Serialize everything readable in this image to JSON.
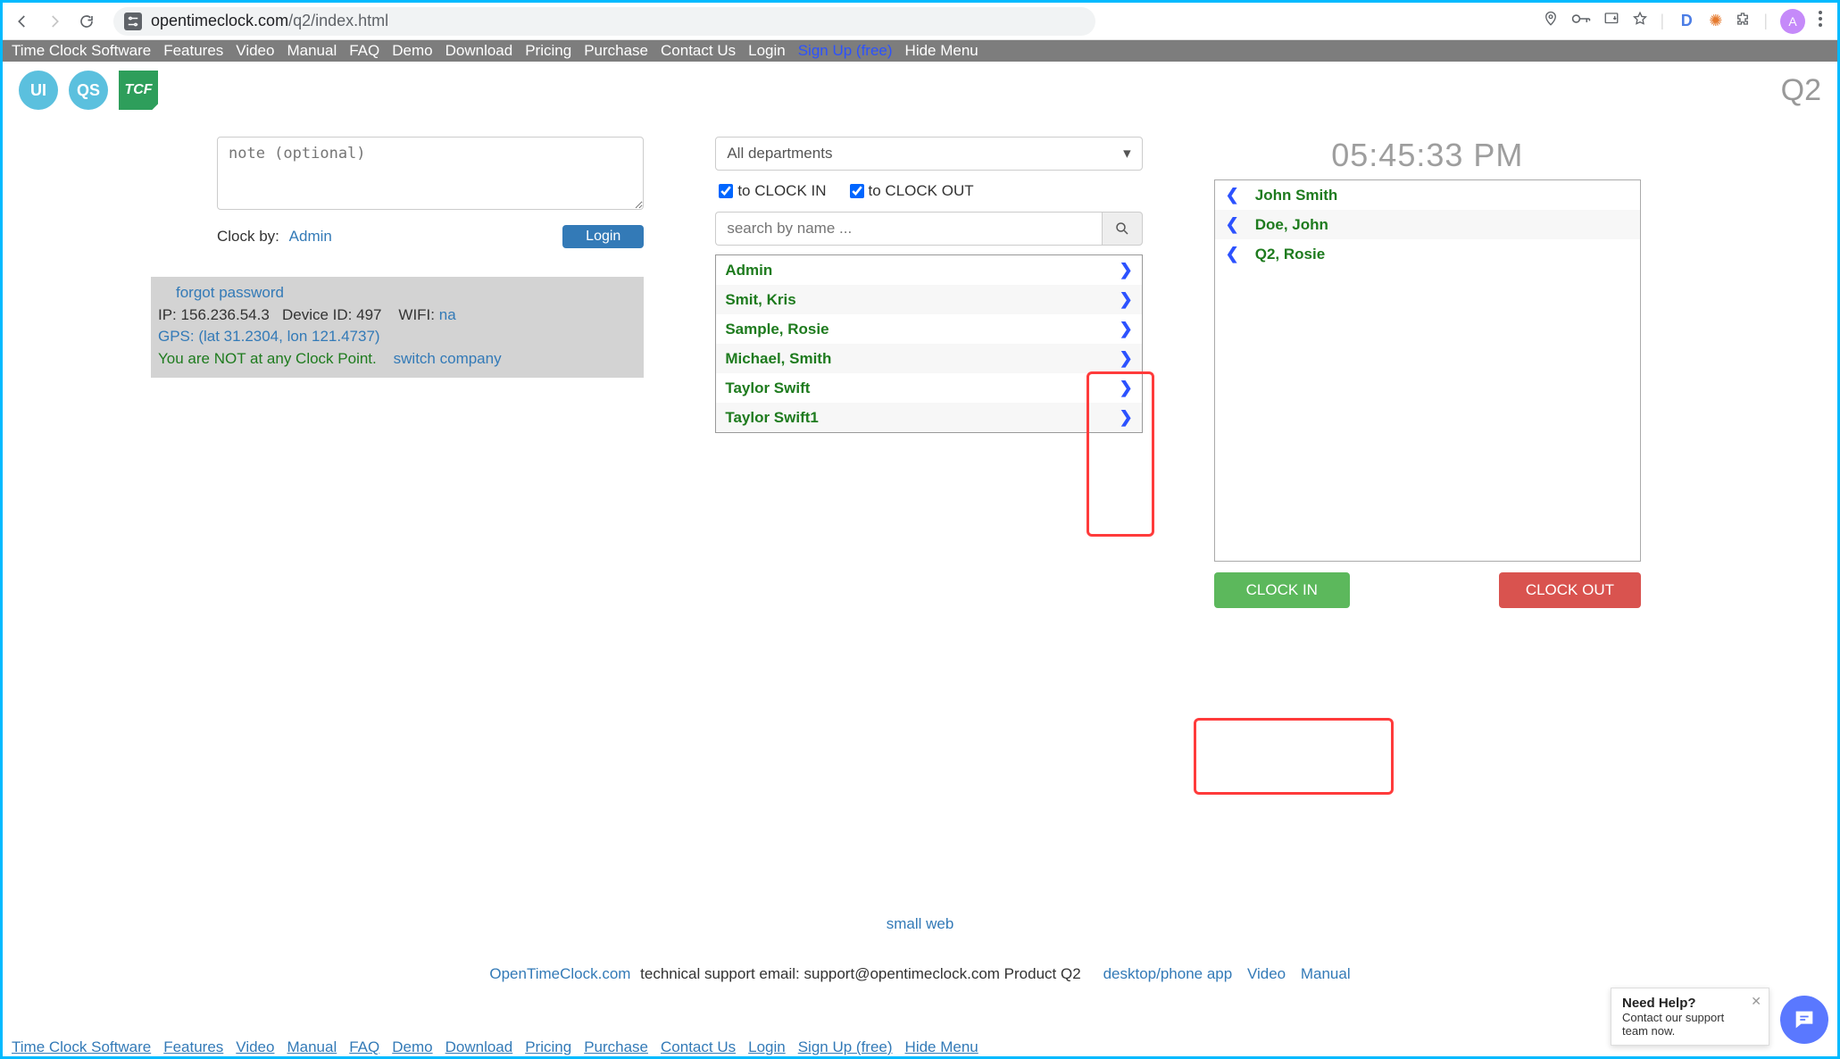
{
  "browser": {
    "url_host": "opentimeclock.com",
    "url_path": "/q2/index.html",
    "avatar": "A",
    "d_ext": "D"
  },
  "menu": {
    "items": [
      "Time Clock Software",
      "Features",
      "Video",
      "Manual",
      "FAQ",
      "Demo",
      "Download",
      "Pricing",
      "Purchase",
      "Contact Us",
      "Login",
      "Sign Up (free)",
      "Hide Menu"
    ],
    "signup_index": 11
  },
  "header": {
    "ui": "UI",
    "qs": "QS",
    "tcf": "TCF",
    "q2": "Q2"
  },
  "left": {
    "note_placeholder": "note (optional)",
    "clock_by_label": "Clock by:",
    "clock_by_user": "Admin",
    "login": "Login",
    "forgot": "forgot password",
    "ip_label": "IP:",
    "ip": "156.236.54.3",
    "device_label": "Device ID:",
    "device": "497",
    "wifi_label": "WIFI:",
    "wifi": "na",
    "gps": "GPS: (lat 31.2304, lon 121.4737)",
    "warn": "You are NOT at any Clock Point.",
    "switch": "switch company"
  },
  "mid": {
    "dept": "All departments",
    "to_in": "to CLOCK IN",
    "to_out": "to CLOCK OUT",
    "search_placeholder": "search by name ...",
    "users": [
      "Admin",
      "Smit, Kris",
      "Sample, Rosie",
      "Michael, Smith",
      "Taylor Swift",
      "Taylor Swift1"
    ]
  },
  "right": {
    "time": "05:45:33 PM",
    "clocked": [
      "John Smith",
      "Doe, John",
      "Q2, Rosie"
    ],
    "clock_in": "CLOCK IN",
    "clock_out": "CLOCK OUT"
  },
  "footer": {
    "small_web": "small web",
    "otc": "OpenTimeClock.com",
    "support_text": " technical support email: support@opentimeclock.com Product Q2",
    "links": [
      "desktop/phone app",
      "Video",
      "Manual"
    ]
  },
  "help": {
    "title": "Need Help?",
    "sub": "Contact our support team now."
  }
}
